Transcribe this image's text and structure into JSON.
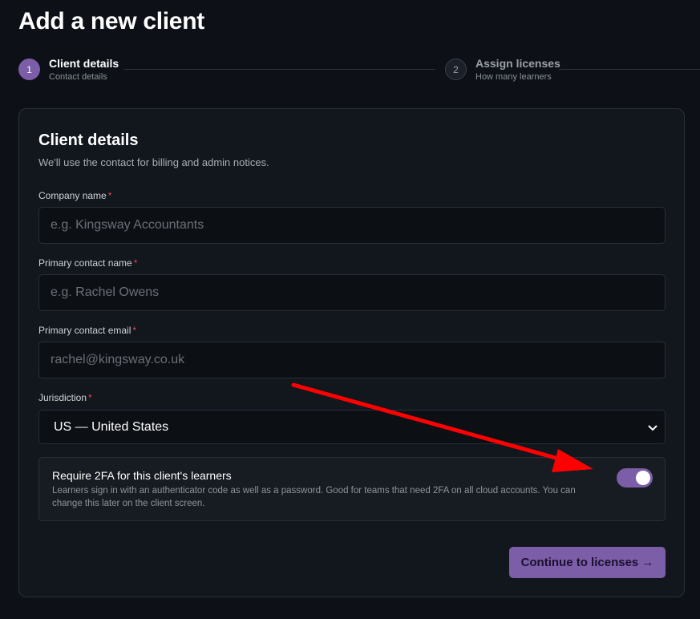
{
  "page": {
    "title": "Add a new client"
  },
  "stepper": {
    "steps": [
      {
        "number": "1",
        "name": "Client details",
        "sub": "Contact details",
        "active": true
      },
      {
        "number": "2",
        "name": "Assign licenses",
        "sub": "How many learners",
        "active": false
      }
    ]
  },
  "card": {
    "title": "Client details",
    "subtitle": "We'll use the contact for billing and admin notices."
  },
  "fields": {
    "company": {
      "label": "Company name",
      "required": "*",
      "placeholder": "e.g. Kingsway Accountants",
      "value": ""
    },
    "contact_name": {
      "label": "Primary contact name",
      "required": "*",
      "placeholder": "e.g. Rachel Owens",
      "value": ""
    },
    "contact_email": {
      "label": "Primary contact email",
      "required": "*",
      "placeholder": "rachel@kingsway.co.uk",
      "value": ""
    },
    "jurisdiction": {
      "label": "Jurisdiction",
      "required": "*",
      "selected": "US — United States"
    }
  },
  "twofa": {
    "title": "Require 2FA for this client's learners",
    "description": "Learners sign in with an authenticator code as well as a password. Good for teams that need 2FA on all cloud accounts. You can change this later on the client screen.",
    "enabled": true
  },
  "actions": {
    "continue_label": "Continue to licenses →"
  },
  "colors": {
    "accent": "#7b5ea7",
    "required": "#e5484d",
    "annotation_arrow": "#ff0000"
  },
  "icons": {
    "select": "chevron-down-icon",
    "annotation": "red-arrow-annotation"
  }
}
